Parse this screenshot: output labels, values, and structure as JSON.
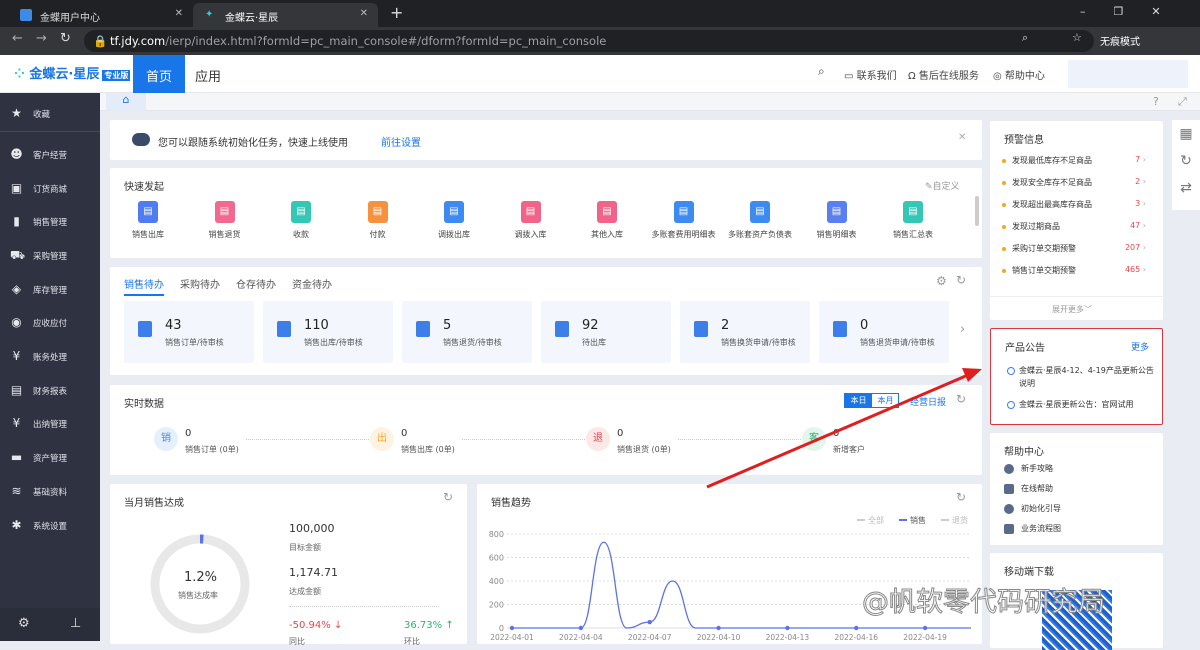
{
  "browser": {
    "tabs": [
      {
        "title": "金蝶用户中心",
        "active": false
      },
      {
        "title": "金蝶云·星辰",
        "active": true
      }
    ],
    "new_tab": "+",
    "url_host": "tf.jdy.com",
    "url_path": "/ierp/index.html?formId=pc_main_console#/dform?formId=pc_main_console",
    "incognito_label": "无痕模式",
    "window_controls": [
      "–",
      "❐",
      "✕"
    ]
  },
  "header": {
    "logo_text": "金蝶云·星辰",
    "logo_badge": "专业版",
    "nav": [
      {
        "label": "首页",
        "active": true
      },
      {
        "label": "应用",
        "active": false
      }
    ],
    "links": [
      "联系我们",
      "售后在线服务",
      "帮助中心"
    ]
  },
  "sidebar": {
    "items": [
      {
        "label": "收藏",
        "icon": "star-icon"
      },
      {
        "label": "客户经营",
        "icon": "user-icon"
      },
      {
        "label": "订货商城",
        "icon": "store-icon"
      },
      {
        "label": "销售管理",
        "icon": "chart-icon"
      },
      {
        "label": "采购管理",
        "icon": "cart-icon"
      },
      {
        "label": "库存管理",
        "icon": "box-icon"
      },
      {
        "label": "应收应付",
        "icon": "coin-icon"
      },
      {
        "label": "账务处理",
        "icon": "yen-icon"
      },
      {
        "label": "财务报表",
        "icon": "report-icon"
      },
      {
        "label": "出纳管理",
        "icon": "cashier-icon"
      },
      {
        "label": "资产管理",
        "icon": "asset-icon"
      },
      {
        "label": "基础资料",
        "icon": "layers-icon"
      },
      {
        "label": "系统设置",
        "icon": "gear-icon"
      }
    ]
  },
  "notice": {
    "text": "您可以跟随系统初始化任务，快速上线使用",
    "link": "前往设置"
  },
  "quick": {
    "title": "快速发起",
    "customize": "自定义",
    "items": [
      {
        "label": "销售出库",
        "color": "#4f7cf0"
      },
      {
        "label": "销售退货",
        "color": "#f06a8f"
      },
      {
        "label": "收款",
        "color": "#35c7b6"
      },
      {
        "label": "付款",
        "color": "#f5923e"
      },
      {
        "label": "调拨出库",
        "color": "#3d8bf0"
      },
      {
        "label": "调拨入库",
        "color": "#f0648a"
      },
      {
        "label": "其他入库",
        "color": "#f0648a"
      },
      {
        "label": "多账套费用明细表",
        "color": "#3d8bf0"
      },
      {
        "label": "多账套资产负债表",
        "color": "#3d8bf0"
      },
      {
        "label": "销售明细表",
        "color": "#5a7ff0"
      },
      {
        "label": "销售汇总表",
        "color": "#35c7b6"
      }
    ]
  },
  "todo": {
    "tabs": [
      {
        "label": "销售待办",
        "active": true
      },
      {
        "label": "采购待办"
      },
      {
        "label": "仓存待办"
      },
      {
        "label": "资金待办"
      }
    ],
    "items": [
      {
        "value": "43",
        "label": "销售订单/待审核"
      },
      {
        "value": "110",
        "label": "销售出库/待审核"
      },
      {
        "value": "5",
        "label": "销售退货/待审核"
      },
      {
        "value": "92",
        "label": "待出库"
      },
      {
        "value": "2",
        "label": "销售换货申请/待审核"
      },
      {
        "value": "0",
        "label": "销售退货申请/待审核"
      }
    ]
  },
  "realtime": {
    "title": "实时数据",
    "toggle": [
      "本日",
      "本月"
    ],
    "report_link": "经营日报",
    "items": [
      {
        "badge": "销",
        "value": "0",
        "label": "销售订单 (0单)",
        "color": "#3d8bf0",
        "bg": "#e6f0fd"
      },
      {
        "badge": "出",
        "value": "0",
        "label": "销售出库 (0单)",
        "color": "#f5a623",
        "bg": "#fef3e2"
      },
      {
        "badge": "退",
        "value": "0",
        "label": "销售退货 (0单)",
        "color": "#e5484d",
        "bg": "#fde8e8"
      },
      {
        "badge": "客",
        "value": "0",
        "label": "新增客户",
        "color": "#2fb36b",
        "bg": "#e3f6ec"
      }
    ]
  },
  "achievement": {
    "title": "当月销售达成",
    "rate": "1.2%",
    "rate_value": 1.2,
    "rate_label": "销售达成率",
    "target_value": "100,000",
    "target_label": "目标金额",
    "actual_value": "1,174.71",
    "actual_label": "达成金额",
    "yoy_value": "-50.94%",
    "yoy_label": "同比",
    "mom_value": "36.73%",
    "mom_label": "环比"
  },
  "warnings": {
    "title": "预警信息",
    "more": "展开更多",
    "items": [
      {
        "label": "发现最低库存不足商品",
        "count": "7"
      },
      {
        "label": "发现安全库存不足商品",
        "count": "2"
      },
      {
        "label": "发现超出最高库存商品",
        "count": "3"
      },
      {
        "label": "发现过期商品",
        "count": "47"
      },
      {
        "label": "采购订单交期预警",
        "count": "207"
      },
      {
        "label": "销售订单交期预警",
        "count": "465"
      }
    ]
  },
  "announcements": {
    "title": "产品公告",
    "more": "更多",
    "items": [
      "金蝶云·星辰4-12、4-19产品更新公告说明",
      "金蝶云·星辰更新公告：官网试用"
    ]
  },
  "help": {
    "title": "帮助中心",
    "items": [
      "新手攻略",
      "在线帮助",
      "初始化引导",
      "业务流程图"
    ]
  },
  "mobile": {
    "title": "移动端下载"
  },
  "watermark": "@帆软零代码研究局",
  "accent": "#1976e8",
  "chart_data": {
    "type": "line",
    "title": "销售趋势",
    "legend": [
      "全部",
      "销售",
      "退货"
    ],
    "legend_placement": "top-right",
    "ylim": [
      0,
      800
    ],
    "yticks": [
      0,
      200,
      400,
      600,
      800
    ],
    "xticks": [
      "2022-04-01",
      "2022-04-04",
      "2022-04-07",
      "2022-04-10",
      "2022-04-13",
      "2022-04-16",
      "2022-04-19"
    ],
    "x": [
      "2022-04-01",
      "2022-04-02",
      "2022-04-03",
      "2022-04-04",
      "2022-04-05",
      "2022-04-06",
      "2022-04-07",
      "2022-04-08",
      "2022-04-09",
      "2022-04-10",
      "2022-04-11",
      "2022-04-12",
      "2022-04-13",
      "2022-04-14",
      "2022-04-15",
      "2022-04-16",
      "2022-04-17",
      "2022-04-18",
      "2022-04-19",
      "2022-04-20",
      "2022-04-21"
    ],
    "series": [
      {
        "name": "销售",
        "color": "#5b73e8",
        "values": [
          0,
          0,
          0,
          0,
          730,
          0,
          50,
          400,
          0,
          0,
          0,
          0,
          0,
          0,
          0,
          0,
          0,
          0,
          0,
          0,
          0
        ]
      }
    ],
    "grid": true
  }
}
